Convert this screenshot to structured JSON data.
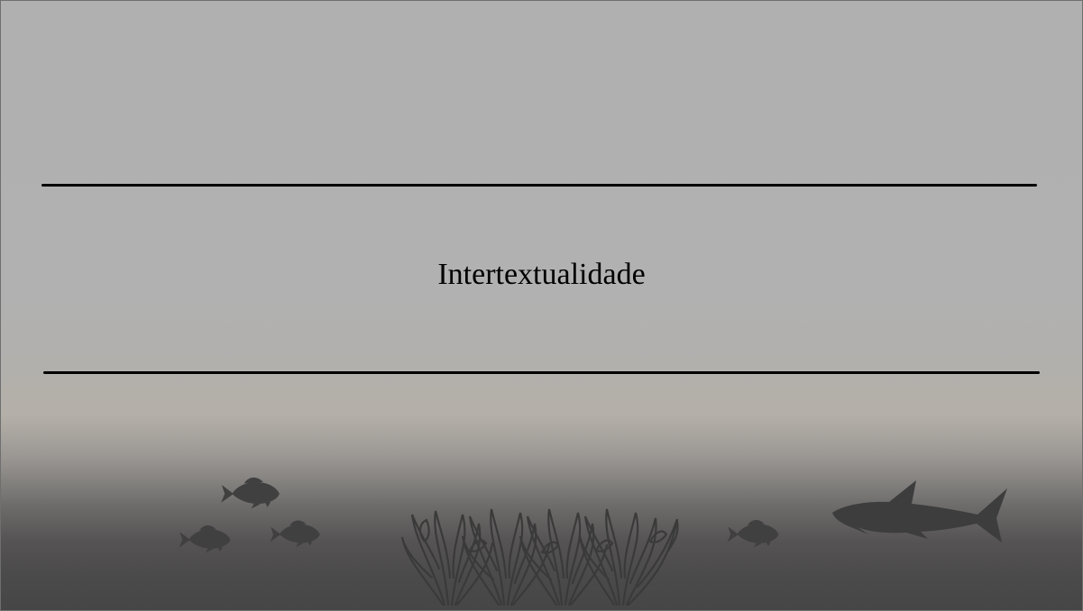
{
  "slide": {
    "title": "Intertextualidade"
  },
  "decorations": {
    "icons": [
      "fish-icon",
      "shark-icon",
      "seaweed-icon"
    ],
    "silhouette_color": "#3f3f3f"
  },
  "colors": {
    "background_top": "#b0b0b0",
    "background_bottom": "#474646",
    "rule": "#000000",
    "title_text": "#000000"
  }
}
